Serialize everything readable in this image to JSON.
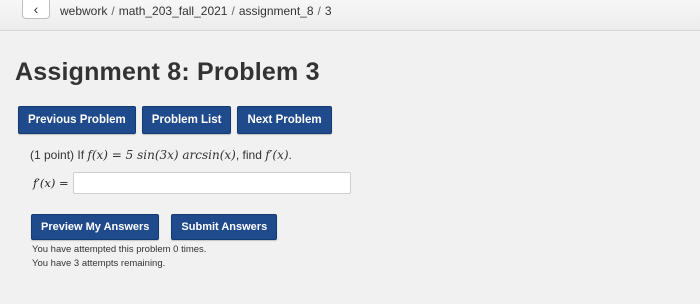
{
  "breadcrumb": {
    "items": [
      "webwork",
      "math_203_fall_2021",
      "assignment_8",
      "3"
    ],
    "separator": "/"
  },
  "back_icon": "chevron-left-icon",
  "page_title": "Assignment 8: Problem 3",
  "nav": {
    "previous": "Previous Problem",
    "list": "Problem List",
    "next": "Next Problem"
  },
  "problem": {
    "points": "(1 point)",
    "if_word": "If",
    "function": "f(x) = 5 sin(3x) arcsin(x)",
    "find_word": ", find",
    "target": "f′(x)",
    "period": "."
  },
  "answer": {
    "label": "f′(x) =",
    "value": ""
  },
  "actions": {
    "preview": "Preview My Answers",
    "submit": "Submit Answers"
  },
  "status": {
    "attempted": "You have attempted this problem 0 times.",
    "remaining": "You have 3 attempts remaining."
  },
  "colors": {
    "button_bg": "#1f4a8c",
    "page_bg": "#f1f1f1"
  }
}
